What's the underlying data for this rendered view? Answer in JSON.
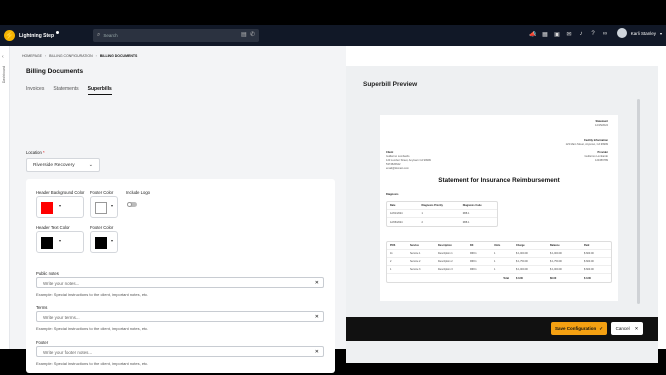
{
  "topbar": {
    "app_name": "Lightning Step",
    "search_placeholder": "Search",
    "icons": [
      "megaphone-icon",
      "calendar-icon",
      "grid-icon",
      "chat-icon",
      "bell-icon",
      "help-icon",
      "link-icon"
    ],
    "user_name": "Karli Stanley"
  },
  "sidebar": {
    "rail_label": "Dashboard"
  },
  "breadcrumb": [
    "HOMEPAGE",
    "BILLING CONFIGURATION",
    "BILLING DOCUMENTS"
  ],
  "page_title": "Billing Documents",
  "tabs": [
    {
      "label": "Invoices",
      "active": false
    },
    {
      "label": "Statements",
      "active": false
    },
    {
      "label": "Superbills",
      "active": true
    }
  ],
  "location": {
    "label": "Location",
    "required_mark": "*",
    "value": "Riverside Recovery"
  },
  "colors": {
    "header_background": {
      "label": "Header Background Color",
      "value": "#ff0000"
    },
    "footer_color_1": {
      "label": "Footer Color",
      "value": "#ffffff"
    },
    "include_logo": {
      "label": "Include Logo",
      "on": false
    },
    "header_text": {
      "label": "Header Text Color",
      "value": "#000000"
    },
    "footer_color_2": {
      "label": "Footer Color",
      "value": "#000000"
    }
  },
  "fields": {
    "public_notes": {
      "label": "Public notes",
      "placeholder": "Write your notes...",
      "hint": "Example: Special instructions to the client, important notes, etc."
    },
    "terms": {
      "label": "Terms",
      "placeholder": "Write your terms...",
      "hint": "Example: Special instructions to the client, important notes, etc."
    },
    "footer": {
      "label": "Footer",
      "placeholder": "Write your footer notes...",
      "hint": "Example: Special instructions to the client, important notes, etc."
    }
  },
  "preview": {
    "title": "Superbill Preview",
    "doc": {
      "statement_label": "Statement",
      "statement_date": "12/15/2024",
      "facility_label": "Facility Information",
      "facility_address": "123 Main Street, Anytown, CA 99999",
      "client_label": "Client",
      "client_lines": [
        "Guillermo Lombardo",
        "123 Lumber Street, Anytown CA 99999",
        "5374526642",
        "email@domain.com"
      ],
      "provider_label": "Provider",
      "provider_lines": [
        "Guillermo Lombardo",
        "123456789"
      ],
      "title": "Statement for Insurance Reimbursement",
      "diagnosis_label": "Diagnosis",
      "diag_headers": [
        "Date",
        "Diagnosis Priority",
        "Diagnosis Code"
      ],
      "diag_rows": [
        [
          "12/01/2024",
          "1",
          "R68.1"
        ],
        [
          "12/06/2024",
          "2",
          "R68.1"
        ]
      ],
      "svc_headers": [
        "POS",
        "Service",
        "Description",
        "DX",
        "Units",
        "Charge",
        "Balance",
        "Paid"
      ],
      "svc_rows": [
        [
          "11",
          "Service 1",
          "Description 1",
          "R68.1",
          "1",
          "$ 1,000.00",
          "$ 1,000.00",
          "$ 600.00"
        ],
        [
          "2",
          "Service 2",
          "Description 2",
          "R68.1",
          "1",
          "$ 1,750.00",
          "$ 1,750.00",
          "$ 600.00"
        ],
        [
          "1",
          "Service 3",
          "Description 3",
          "R68.1",
          "1",
          "$ 1,000.00",
          "$ 1,000.00",
          "$ 600.00"
        ]
      ],
      "total_label": "Total",
      "total_values": [
        "$ 0.00",
        "$0.00",
        "$ 0.00"
      ]
    }
  },
  "actions": {
    "save_label": "Save Configuration",
    "cancel_label": "Cancel"
  }
}
